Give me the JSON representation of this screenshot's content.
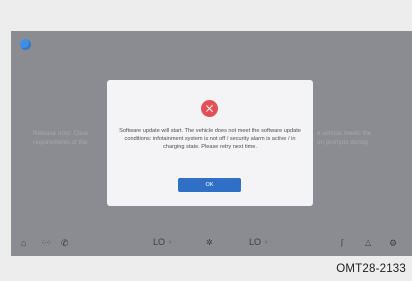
{
  "background_text": {
    "left_line1": "Release note: Clear",
    "left_line2": "requirements of the",
    "right_line1": "e vehicle meets the",
    "right_line2": "on prompts during"
  },
  "dialog": {
    "icon": "error-x-icon",
    "icon_color": "#e35057",
    "message": "Software update will start. The vehicle does not meet the software update conditions: infotainment system is not off / security alarm is active / in charging state. Please retry next time.",
    "ok_label": "OK",
    "ok_color": "#2f6fc6"
  },
  "bottom_bar": {
    "home_icon": "⌂",
    "apps_icon": "⁘⁘",
    "phone_icon": "✆",
    "temp_left": "LO",
    "temp_left_arrow": "›",
    "fan_icon": "✲",
    "temp_right": "LO",
    "temp_right_arrow": "›",
    "steering_icon": "ʃ",
    "warning_icon": "△",
    "settings_icon": "⚙"
  },
  "caption": "OMT28-2133"
}
